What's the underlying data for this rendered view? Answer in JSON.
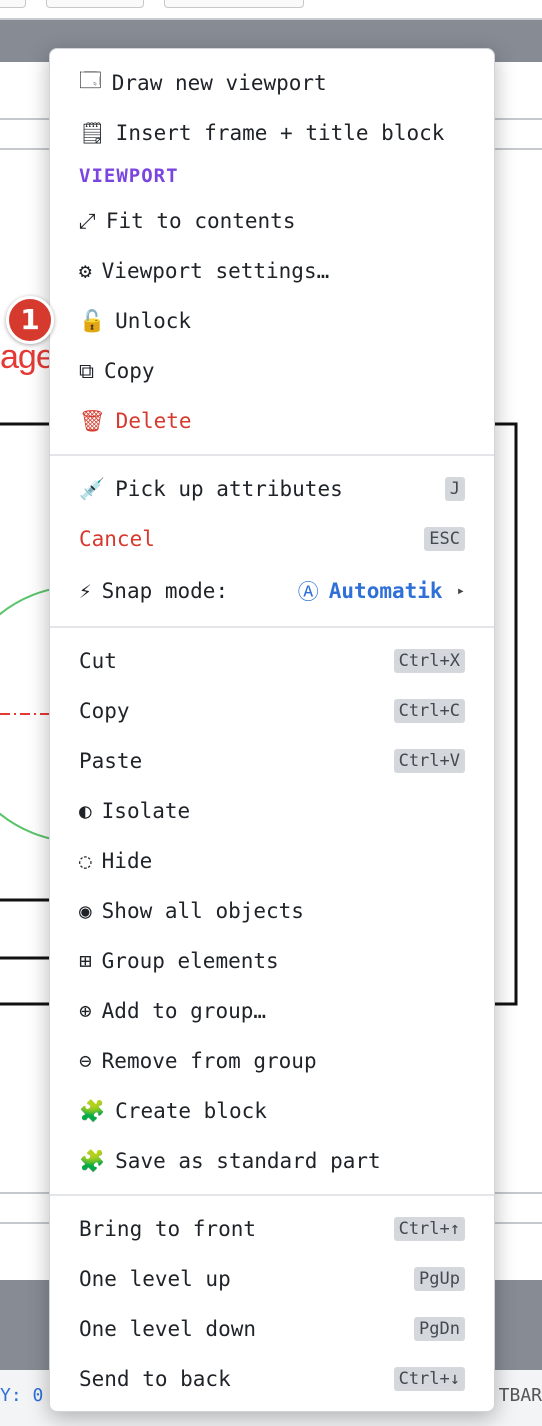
{
  "status_bar": {
    "left_text": "Y: 0",
    "right_text": "TBAR"
  },
  "background": {
    "red_label": "ager"
  },
  "badge": {
    "number": "1"
  },
  "menu": {
    "top_items": [
      {
        "icon": "window-icon",
        "glyph": "🗔",
        "label": "Draw new viewport"
      },
      {
        "icon": "clipboard-icon",
        "glyph": "🗒",
        "label": "Insert frame + title block"
      }
    ],
    "viewport_section": {
      "title": "VIEWPORT",
      "items": [
        {
          "icon": "resize-icon",
          "glyph": "⤢",
          "label": "Fit to contents"
        },
        {
          "icon": "gear-icon",
          "glyph": "⚙",
          "label": "Viewport settings…"
        },
        {
          "icon": "unlock-icon",
          "glyph": "🔓",
          "label": "Unlock"
        },
        {
          "icon": "copy-icon",
          "glyph": "⧉",
          "label": "Copy"
        },
        {
          "icon": "trash-icon",
          "glyph": "🗑",
          "label": "Delete"
        }
      ]
    },
    "attributes": {
      "pick_up": {
        "glyph": "💉",
        "label": "Pick up attributes",
        "shortcut": "J"
      },
      "cancel": {
        "label": "Cancel",
        "shortcut": "ESC"
      },
      "snap": {
        "glyph": "⚡",
        "label": "Snap mode:",
        "value_glyph": "Ⓐ",
        "value": "Automatik",
        "arrow": "▸"
      }
    },
    "edit_items": [
      {
        "label": "Cut",
        "shortcut": "Ctrl+X"
      },
      {
        "label": "Copy",
        "shortcut": "Ctrl+C"
      },
      {
        "label": "Paste",
        "shortcut": "Ctrl+V"
      },
      {
        "icon": "contrast-icon",
        "glyph": "◐",
        "label": "Isolate"
      },
      {
        "icon": "dotted-circle-icon",
        "glyph": "◌",
        "label": "Hide"
      },
      {
        "icon": "target-icon",
        "glyph": "◉",
        "label": "Show all objects"
      },
      {
        "icon": "grid-icon",
        "glyph": "⊞",
        "label": "Group elements"
      },
      {
        "icon": "circle-plus-icon",
        "glyph": "⊕",
        "label": "Add to group…"
      },
      {
        "icon": "circle-minus-icon",
        "glyph": "⊖",
        "label": "Remove from group"
      },
      {
        "icon": "puzzle-icon",
        "glyph": "🧩",
        "label": "Create block"
      },
      {
        "icon": "puzzle-icon",
        "glyph": "🧩",
        "label": "Save as standard part"
      }
    ],
    "order_items": [
      {
        "label": "Bring to front",
        "shortcut": "Ctrl+↑"
      },
      {
        "label": "One level up",
        "shortcut": "PgUp"
      },
      {
        "label": "One level down",
        "shortcut": "PgDn"
      },
      {
        "label": "Send to back",
        "shortcut": "Ctrl+↓"
      }
    ]
  }
}
